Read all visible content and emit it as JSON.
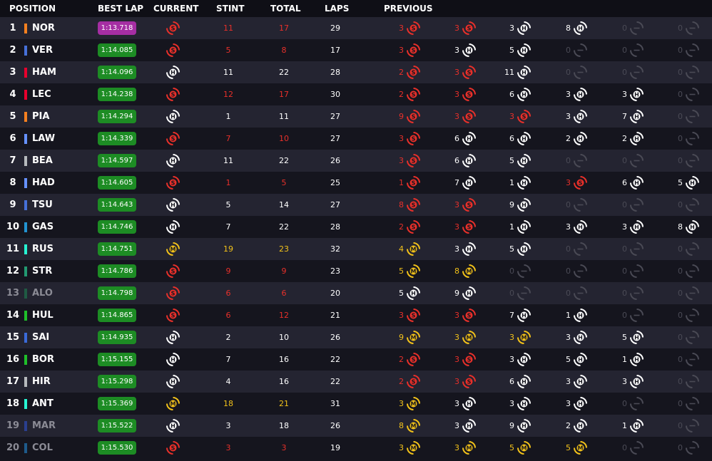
{
  "headers": {
    "position": "POSITION",
    "best_lap": "BEST LAP",
    "current": "CURRENT",
    "stint": "STINT",
    "total": "TOTAL",
    "laps": "LAPS",
    "previous": "PREVIOUS"
  },
  "colors": {
    "soft": "#e8302a",
    "medium": "#f2c21a",
    "hard": "#ffffff",
    "empty": "#4a4a55",
    "empty_text": "#4a4a55"
  },
  "rows": [
    {
      "pos": "1",
      "abbr": "NOR",
      "team": "#f58020",
      "best": "1:13.718",
      "best_style": "purple",
      "cur": "S",
      "stint": "11",
      "total": "17",
      "laps": "29",
      "dim": false,
      "prev": [
        {
          "n": "3",
          "t": "S"
        },
        {
          "n": "3",
          "t": "S"
        },
        {
          "n": "3",
          "t": "H"
        },
        {
          "n": "8",
          "t": "H"
        },
        {
          "n": "0",
          "t": "E"
        },
        {
          "n": "0",
          "t": "E"
        }
      ]
    },
    {
      "pos": "2",
      "abbr": "VER",
      "team": "#4670d8",
      "best": "1:14.085",
      "best_style": "green",
      "cur": "S",
      "stint": "5",
      "total": "8",
      "laps": "17",
      "dim": false,
      "prev": [
        {
          "n": "3",
          "t": "S"
        },
        {
          "n": "3",
          "t": "H"
        },
        {
          "n": "5",
          "t": "H"
        },
        {
          "n": "0",
          "t": "E"
        },
        {
          "n": "0",
          "t": "E"
        },
        {
          "n": "0",
          "t": "E"
        }
      ]
    },
    {
      "pos": "3",
      "abbr": "HAM",
      "team": "#e8002d",
      "best": "1:14.096",
      "best_style": "green",
      "cur": "H",
      "stint": "11",
      "total": "22",
      "laps": "28",
      "dim": false,
      "prev": [
        {
          "n": "2",
          "t": "S"
        },
        {
          "n": "3",
          "t": "S"
        },
        {
          "n": "11",
          "t": "H"
        },
        {
          "n": "0",
          "t": "E"
        },
        {
          "n": "0",
          "t": "E"
        },
        {
          "n": "0",
          "t": "E"
        }
      ]
    },
    {
      "pos": "4",
      "abbr": "LEC",
      "team": "#e8002d",
      "best": "1:14.238",
      "best_style": "green",
      "cur": "S",
      "stint": "12",
      "total": "17",
      "laps": "30",
      "dim": false,
      "prev": [
        {
          "n": "2",
          "t": "S"
        },
        {
          "n": "3",
          "t": "S"
        },
        {
          "n": "6",
          "t": "H"
        },
        {
          "n": "3",
          "t": "H"
        },
        {
          "n": "3",
          "t": "H"
        },
        {
          "n": "0",
          "t": "E"
        }
      ]
    },
    {
      "pos": "5",
      "abbr": "PIA",
      "team": "#f58020",
      "best": "1:14.294",
      "best_style": "green",
      "cur": "H",
      "stint": "1",
      "total": "11",
      "laps": "27",
      "dim": false,
      "prev": [
        {
          "n": "9",
          "t": "S"
        },
        {
          "n": "3",
          "t": "S"
        },
        {
          "n": "3",
          "t": "S"
        },
        {
          "n": "3",
          "t": "H"
        },
        {
          "n": "7",
          "t": "H"
        },
        {
          "n": "0",
          "t": "E"
        }
      ]
    },
    {
      "pos": "6",
      "abbr": "LAW",
      "team": "#6692ff",
      "best": "1:14.339",
      "best_style": "green",
      "cur": "S",
      "stint": "7",
      "total": "10",
      "laps": "27",
      "dim": false,
      "prev": [
        {
          "n": "3",
          "t": "S"
        },
        {
          "n": "6",
          "t": "H"
        },
        {
          "n": "6",
          "t": "H"
        },
        {
          "n": "2",
          "t": "H"
        },
        {
          "n": "2",
          "t": "H"
        },
        {
          "n": "0",
          "t": "E"
        }
      ]
    },
    {
      "pos": "7",
      "abbr": "BEA",
      "team": "#b6babd",
      "best": "1:14.597",
      "best_style": "green",
      "cur": "H",
      "stint": "11",
      "total": "22",
      "laps": "26",
      "dim": false,
      "prev": [
        {
          "n": "3",
          "t": "S"
        },
        {
          "n": "6",
          "t": "H"
        },
        {
          "n": "5",
          "t": "H"
        },
        {
          "n": "0",
          "t": "E"
        },
        {
          "n": "0",
          "t": "E"
        },
        {
          "n": "0",
          "t": "E"
        }
      ]
    },
    {
      "pos": "8",
      "abbr": "HAD",
      "team": "#6692ff",
      "best": "1:14.605",
      "best_style": "green",
      "cur": "S",
      "stint": "1",
      "total": "5",
      "laps": "25",
      "dim": false,
      "prev": [
        {
          "n": "1",
          "t": "S"
        },
        {
          "n": "7",
          "t": "H"
        },
        {
          "n": "1",
          "t": "H"
        },
        {
          "n": "3",
          "t": "S"
        },
        {
          "n": "6",
          "t": "H"
        },
        {
          "n": "5",
          "t": "H"
        }
      ]
    },
    {
      "pos": "9",
      "abbr": "TSU",
      "team": "#4670d8",
      "best": "1:14.643",
      "best_style": "green",
      "cur": "H",
      "stint": "5",
      "total": "14",
      "laps": "27",
      "dim": false,
      "prev": [
        {
          "n": "8",
          "t": "S"
        },
        {
          "n": "3",
          "t": "S"
        },
        {
          "n": "9",
          "t": "H"
        },
        {
          "n": "0",
          "t": "E"
        },
        {
          "n": "0",
          "t": "E"
        },
        {
          "n": "0",
          "t": "E"
        }
      ]
    },
    {
      "pos": "10",
      "abbr": "GAS",
      "team": "#2293d1",
      "best": "1:14.746",
      "best_style": "green",
      "cur": "H",
      "stint": "7",
      "total": "22",
      "laps": "28",
      "dim": false,
      "prev": [
        {
          "n": "2",
          "t": "S"
        },
        {
          "n": "3",
          "t": "S"
        },
        {
          "n": "1",
          "t": "H"
        },
        {
          "n": "3",
          "t": "H"
        },
        {
          "n": "3",
          "t": "H"
        },
        {
          "n": "8",
          "t": "H"
        }
      ]
    },
    {
      "pos": "11",
      "abbr": "RUS",
      "team": "#27f4d2",
      "best": "1:14.751",
      "best_style": "green",
      "cur": "M",
      "stint": "19",
      "total": "23",
      "laps": "32",
      "dim": false,
      "prev": [
        {
          "n": "4",
          "t": "M"
        },
        {
          "n": "3",
          "t": "H"
        },
        {
          "n": "5",
          "t": "H"
        },
        {
          "n": "0",
          "t": "E"
        },
        {
          "n": "0",
          "t": "E"
        },
        {
          "n": "0",
          "t": "E"
        }
      ]
    },
    {
      "pos": "12",
      "abbr": "STR",
      "team": "#229971",
      "best": "1:14.786",
      "best_style": "green",
      "cur": "S",
      "stint": "9",
      "total": "9",
      "laps": "23",
      "dim": false,
      "prev": [
        {
          "n": "5",
          "t": "M"
        },
        {
          "n": "8",
          "t": "M"
        },
        {
          "n": "0",
          "t": "E"
        },
        {
          "n": "0",
          "t": "E"
        },
        {
          "n": "0",
          "t": "E"
        },
        {
          "n": "0",
          "t": "E"
        }
      ]
    },
    {
      "pos": "13",
      "abbr": "ALO",
      "team": "#1f5a43",
      "best": "1:14.798",
      "best_style": "green",
      "cur": "S",
      "stint": "6",
      "total": "6",
      "laps": "20",
      "dim": true,
      "prev": [
        {
          "n": "5",
          "t": "H"
        },
        {
          "n": "9",
          "t": "H"
        },
        {
          "n": "0",
          "t": "E"
        },
        {
          "n": "0",
          "t": "E"
        },
        {
          "n": "0",
          "t": "E"
        },
        {
          "n": "0",
          "t": "E"
        }
      ]
    },
    {
      "pos": "14",
      "abbr": "HUL",
      "team": "#1fbf2a",
      "best": "1:14.865",
      "best_style": "green",
      "cur": "S",
      "stint": "6",
      "total": "12",
      "laps": "21",
      "dim": false,
      "prev": [
        {
          "n": "3",
          "t": "S"
        },
        {
          "n": "3",
          "t": "S"
        },
        {
          "n": "7",
          "t": "H"
        },
        {
          "n": "1",
          "t": "H"
        },
        {
          "n": "0",
          "t": "E"
        },
        {
          "n": "0",
          "t": "E"
        }
      ]
    },
    {
      "pos": "15",
      "abbr": "SAI",
      "team": "#3a6ad8",
      "best": "1:14.935",
      "best_style": "green",
      "cur": "H",
      "stint": "2",
      "total": "10",
      "laps": "26",
      "dim": false,
      "prev": [
        {
          "n": "9",
          "t": "M"
        },
        {
          "n": "3",
          "t": "M"
        },
        {
          "n": "3",
          "t": "M"
        },
        {
          "n": "3",
          "t": "H"
        },
        {
          "n": "5",
          "t": "H"
        },
        {
          "n": "0",
          "t": "E"
        }
      ]
    },
    {
      "pos": "16",
      "abbr": "BOR",
      "team": "#1fbf2a",
      "best": "1:15.155",
      "best_style": "green",
      "cur": "H",
      "stint": "7",
      "total": "16",
      "laps": "22",
      "dim": false,
      "prev": [
        {
          "n": "2",
          "t": "S"
        },
        {
          "n": "3",
          "t": "S"
        },
        {
          "n": "3",
          "t": "H"
        },
        {
          "n": "5",
          "t": "H"
        },
        {
          "n": "1",
          "t": "H"
        },
        {
          "n": "0",
          "t": "E"
        }
      ]
    },
    {
      "pos": "17",
      "abbr": "HIR",
      "team": "#b6babd",
      "best": "1:15.298",
      "best_style": "green",
      "cur": "H",
      "stint": "4",
      "total": "16",
      "laps": "22",
      "dim": false,
      "prev": [
        {
          "n": "2",
          "t": "S"
        },
        {
          "n": "3",
          "t": "S"
        },
        {
          "n": "6",
          "t": "H"
        },
        {
          "n": "3",
          "t": "H"
        },
        {
          "n": "3",
          "t": "H"
        },
        {
          "n": "0",
          "t": "E"
        }
      ]
    },
    {
      "pos": "18",
      "abbr": "ANT",
      "team": "#27f4d2",
      "best": "1:15.369",
      "best_style": "green",
      "cur": "M",
      "stint": "18",
      "total": "21",
      "laps": "31",
      "dim": false,
      "prev": [
        {
          "n": "3",
          "t": "M"
        },
        {
          "n": "3",
          "t": "H"
        },
        {
          "n": "3",
          "t": "H"
        },
        {
          "n": "3",
          "t": "H"
        },
        {
          "n": "0",
          "t": "E"
        },
        {
          "n": "0",
          "t": "E"
        }
      ]
    },
    {
      "pos": "19",
      "abbr": "MAR",
      "team": "#2a3f8f",
      "best": "1:15.522",
      "best_style": "green",
      "cur": "H",
      "stint": "3",
      "total": "18",
      "laps": "26",
      "dim": true,
      "prev": [
        {
          "n": "8",
          "t": "M"
        },
        {
          "n": "3",
          "t": "H"
        },
        {
          "n": "9",
          "t": "H"
        },
        {
          "n": "2",
          "t": "H"
        },
        {
          "n": "1",
          "t": "H"
        },
        {
          "n": "0",
          "t": "E"
        }
      ]
    },
    {
      "pos": "20",
      "abbr": "COL",
      "team": "#1e5a8a",
      "best": "1:15.530",
      "best_style": "green",
      "cur": "S",
      "stint": "3",
      "total": "3",
      "laps": "19",
      "dim": true,
      "prev": [
        {
          "n": "3",
          "t": "M"
        },
        {
          "n": "3",
          "t": "M"
        },
        {
          "n": "5",
          "t": "M"
        },
        {
          "n": "5",
          "t": "M"
        },
        {
          "n": "0",
          "t": "E"
        },
        {
          "n": "0",
          "t": "E"
        }
      ]
    }
  ]
}
